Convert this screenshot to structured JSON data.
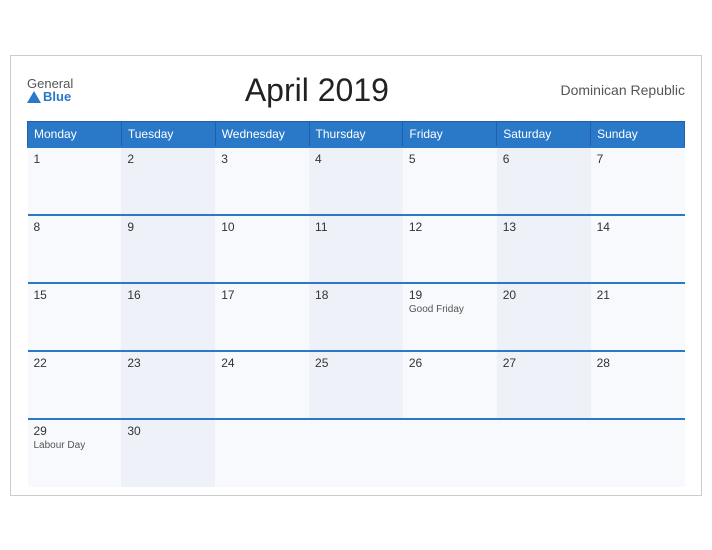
{
  "header": {
    "logo_general": "General",
    "logo_blue": "Blue",
    "title": "April 2019",
    "country": "Dominican Republic"
  },
  "days_of_week": [
    "Monday",
    "Tuesday",
    "Wednesday",
    "Thursday",
    "Friday",
    "Saturday",
    "Sunday"
  ],
  "weeks": [
    [
      {
        "day": "1",
        "event": ""
      },
      {
        "day": "2",
        "event": ""
      },
      {
        "day": "3",
        "event": ""
      },
      {
        "day": "4",
        "event": ""
      },
      {
        "day": "5",
        "event": ""
      },
      {
        "day": "6",
        "event": ""
      },
      {
        "day": "7",
        "event": ""
      }
    ],
    [
      {
        "day": "8",
        "event": ""
      },
      {
        "day": "9",
        "event": ""
      },
      {
        "day": "10",
        "event": ""
      },
      {
        "day": "11",
        "event": ""
      },
      {
        "day": "12",
        "event": ""
      },
      {
        "day": "13",
        "event": ""
      },
      {
        "day": "14",
        "event": ""
      }
    ],
    [
      {
        "day": "15",
        "event": ""
      },
      {
        "day": "16",
        "event": ""
      },
      {
        "day": "17",
        "event": ""
      },
      {
        "day": "18",
        "event": ""
      },
      {
        "day": "19",
        "event": "Good Friday"
      },
      {
        "day": "20",
        "event": ""
      },
      {
        "day": "21",
        "event": ""
      }
    ],
    [
      {
        "day": "22",
        "event": ""
      },
      {
        "day": "23",
        "event": ""
      },
      {
        "day": "24",
        "event": ""
      },
      {
        "day": "25",
        "event": ""
      },
      {
        "day": "26",
        "event": ""
      },
      {
        "day": "27",
        "event": ""
      },
      {
        "day": "28",
        "event": ""
      }
    ],
    [
      {
        "day": "29",
        "event": "Labour Day"
      },
      {
        "day": "30",
        "event": ""
      },
      {
        "day": "",
        "event": ""
      },
      {
        "day": "",
        "event": ""
      },
      {
        "day": "",
        "event": ""
      },
      {
        "day": "",
        "event": ""
      },
      {
        "day": "",
        "event": ""
      }
    ]
  ]
}
